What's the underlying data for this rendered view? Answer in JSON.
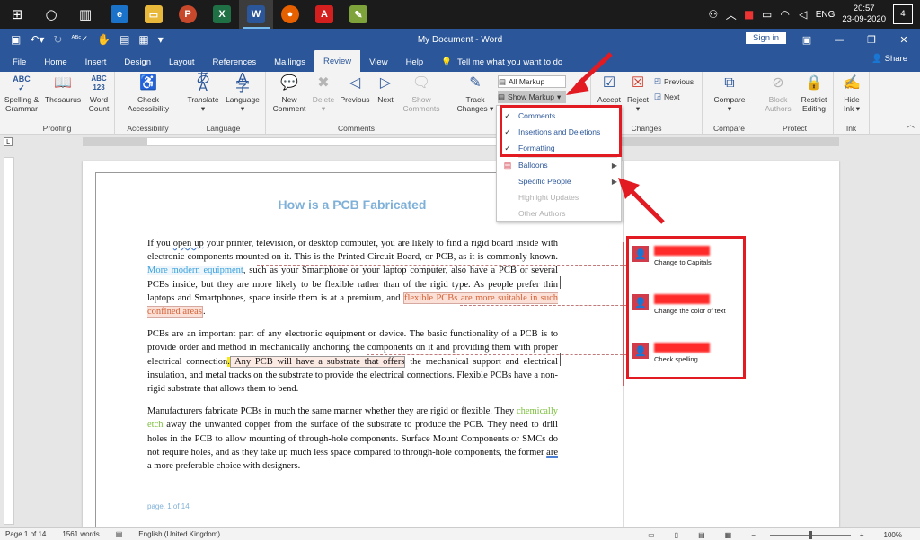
{
  "taskbar": {
    "apps": [
      "Edge",
      "File Explorer",
      "PowerPoint",
      "Excel",
      "Word",
      "Firefox",
      "Acrobat",
      "Notepad"
    ],
    "language": "ENG",
    "time": "20:57",
    "date": "23-09-2020",
    "notification_count": "4"
  },
  "titlebar": {
    "title": "My Document  -  Word",
    "signin": "Sign in"
  },
  "ribbon_tabs": [
    "File",
    "Home",
    "Insert",
    "Design",
    "Layout",
    "References",
    "Mailings",
    "Review",
    "View",
    "Help"
  ],
  "active_tab": "Review",
  "tell_me": "Tell me what you want to do",
  "share": "Share",
  "ribbon": {
    "proofing": {
      "label": "Proofing",
      "spelling": [
        "Spelling &",
        "Grammar"
      ],
      "thesaurus": "Thesaurus",
      "word_count": [
        "Word",
        "Count"
      ]
    },
    "accessibility": {
      "label": "Accessibility",
      "check": [
        "Check",
        "Accessibility"
      ]
    },
    "language": {
      "label": "Language",
      "translate": "Translate",
      "language": "Language"
    },
    "comments": {
      "label": "Comments",
      "new": [
        "New",
        "Comment"
      ],
      "delete": "Delete",
      "previous": "Previous",
      "next": "Next",
      "show": [
        "Show",
        "Comments"
      ]
    },
    "tracking": {
      "track": [
        "Track",
        "Changes"
      ],
      "all_markup": "All Markup",
      "show_markup": "Show Markup"
    },
    "changes": {
      "label": "Changes",
      "accept": "Accept",
      "reject": "Reject",
      "previous": "Previous",
      "next": "Next"
    },
    "compare": {
      "label": "Compare",
      "compare": "Compare"
    },
    "protect": {
      "label": "Protect",
      "block": [
        "Block",
        "Authors"
      ],
      "restrict": [
        "Restrict",
        "Editing"
      ]
    },
    "ink": {
      "label": "Ink",
      "hide": [
        "Hide",
        "Ink"
      ]
    }
  },
  "show_markup_menu": {
    "items": [
      {
        "label": "Comments",
        "checked": true
      },
      {
        "label": "Insertions and Deletions",
        "checked": true
      },
      {
        "label": "Formatting",
        "checked": true
      },
      {
        "label": "Balloons",
        "submenu": true
      },
      {
        "label": "Specific People",
        "submenu": true
      },
      {
        "label": "Highlight Updates",
        "disabled": true
      },
      {
        "label": "Other Authors",
        "disabled": true
      }
    ]
  },
  "document": {
    "heading": "How is a PCB Fabricated",
    "p1_a": "If you ",
    "p1_b": "open up",
    "p1_c": " your printer, television, or desktop computer, you are likely to find a rigid board inside with electronic components mounted on it. This is the Printed Circuit Board, or PCB, as it is commonly known. ",
    "p1_ins": "More modern equipment",
    "p1_d": ", such as your Smartphone or your laptop computer, also have a PCB or several PCBs inside, but they are more likely to be flexible rather than of the rigid type. As people prefer thin laptops and Smartphones, space inside them is at a premium, and ",
    "p1_fmt": "flexible PCBs are more suitable in such confined areas",
    "p1_e": ".",
    "p2_a": "PCBs are an important part of any electronic equipment or device. The basic functionality of a PCB is to provide order and method in mechanically anchoring the components on it and providing them with proper electrical connection",
    "p2_hl": ".",
    "p2_box": " Any PCB will have a substrate that offers",
    "p2_b": " the mechanical support and electrical insulation, and metal tracks on the substrate to provide the electrical connections. Flexible PCBs have a non-rigid substrate that allows them to bend.",
    "p3_a": "Manufacturers fabricate PCBs in much the same manner whether they are rigid or flexible. They ",
    "p3_green": "chemically etch",
    "p3_b": " away the unwanted copper from the surface of the substrate to produce the PCB. They need to drill holes in the PCB to allow mounting of through-hole components. Surface Mount Components or SMCs do not require holes, and as they take up much less space compared to through-hole components, the former ",
    "p3_are": "are",
    "p3_c": " a more preferable choice with designers.",
    "footer": "page. 1 of 14"
  },
  "comments": [
    {
      "text": "Change to Capitals"
    },
    {
      "text": "Change the color of text"
    },
    {
      "text": "Check spelling"
    }
  ],
  "statusbar": {
    "page": "Page 1 of 14",
    "words": "1561 words",
    "language": "English (United Kingdom)",
    "zoom": "100%"
  },
  "colors": {
    "word_blue": "#2b579a",
    "annotation_red": "#e21b23"
  }
}
